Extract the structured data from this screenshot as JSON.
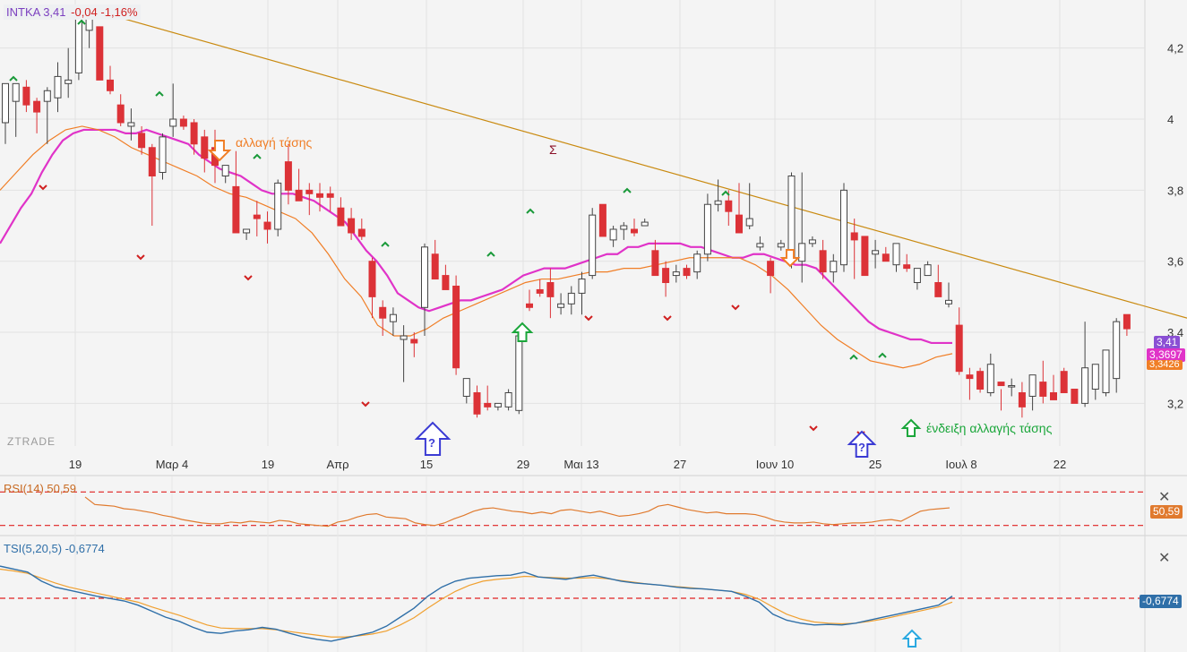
{
  "header": {
    "symbol": "INTKA",
    "last": "3,41",
    "change": "-0,04 -1,16%"
  },
  "watermark": "ZTRADE",
  "annotations": {
    "trend_change": "αλλαγή τάσης",
    "trend_change_signal": "ένδειξη αλλαγής τάσης",
    "sigma": "Σ",
    "question": "?"
  },
  "price_tags": {
    "last": "3,41",
    "ema_fast": "3,3697",
    "ema_slow": "3,3426"
  },
  "rsi": {
    "label": "RSI(14) 50,59",
    "tag": "50,59"
  },
  "tsi": {
    "label": "TSI(5,20,5) -0,6774",
    "tag": "-0,6774"
  },
  "colors": {
    "up": "#ffffff",
    "down": "#dc3237",
    "ema_fast": "#e033c8",
    "ema_slow": "#f07e26",
    "trendline": "#c98a10",
    "rsi": "#e07a2e",
    "tsi": "#2f6fa8",
    "tsi_signal": "#f0a030",
    "level": "#e02020"
  },
  "chart_data": [
    {
      "type": "candlestick",
      "title": "INTKA",
      "x_ticks": [
        "19",
        "Μαρ 4",
        "19",
        "Απρ",
        "15",
        "29",
        "Μαι 13",
        "27",
        "Ιουν 10",
        "25",
        "Ιουλ 8",
        "22"
      ],
      "y_ticks": [
        "3,2",
        "3,4",
        "3,6",
        "3,8",
        "4",
        "4,2"
      ],
      "ylim": [
        3.08,
        4.3
      ],
      "candles": [
        {
          "o": 3.99,
          "h": 4.06,
          "l": 3.93,
          "c": 4.1
        },
        {
          "o": 4.05,
          "h": 4.06,
          "l": 3.95,
          "c": 4.1
        },
        {
          "o": 4.09,
          "h": 4.11,
          "l": 4.02,
          "c": 4.04
        },
        {
          "o": 4.05,
          "h": 4.06,
          "l": 3.96,
          "c": 4.02
        },
        {
          "o": 4.05,
          "h": 4.09,
          "l": 3.93,
          "c": 4.08
        },
        {
          "o": 4.06,
          "h": 4.16,
          "l": 4.02,
          "c": 4.12
        },
        {
          "o": 4.1,
          "h": 4.2,
          "l": 4.06,
          "c": 4.11
        },
        {
          "o": 4.13,
          "h": 4.3,
          "l": 4.11,
          "c": 4.29
        },
        {
          "o": 4.25,
          "h": 4.31,
          "l": 4.2,
          "c": 4.3
        },
        {
          "o": 4.26,
          "h": 4.25,
          "l": 4.11,
          "c": 4.11
        },
        {
          "o": 4.11,
          "h": 4.15,
          "l": 4.07,
          "c": 4.08
        },
        {
          "o": 4.04,
          "h": 4.07,
          "l": 3.98,
          "c": 3.99
        },
        {
          "o": 3.98,
          "h": 4.03,
          "l": 3.94,
          "c": 3.99
        },
        {
          "o": 3.96,
          "h": 3.98,
          "l": 3.9,
          "c": 3.92
        },
        {
          "o": 3.92,
          "h": 3.93,
          "l": 3.7,
          "c": 3.84
        },
        {
          "o": 3.85,
          "h": 3.96,
          "l": 3.83,
          "c": 3.95
        },
        {
          "o": 3.98,
          "h": 4.1,
          "l": 3.95,
          "c": 4.0
        },
        {
          "o": 4.0,
          "h": 4.01,
          "l": 3.97,
          "c": 3.98
        },
        {
          "o": 3.99,
          "h": 4.0,
          "l": 3.9,
          "c": 3.93
        },
        {
          "o": 3.95,
          "h": 3.97,
          "l": 3.85,
          "c": 3.89
        },
        {
          "o": 3.92,
          "h": 3.97,
          "l": 3.82,
          "c": 3.87
        },
        {
          "o": 3.84,
          "h": 3.85,
          "l": 3.82,
          "c": 3.87
        },
        {
          "o": 3.81,
          "h": 3.91,
          "l": 3.68,
          "c": 3.68
        },
        {
          "o": 3.68,
          "h": 3.69,
          "l": 3.66,
          "c": 3.69
        },
        {
          "o": 3.73,
          "h": 3.77,
          "l": 3.67,
          "c": 3.72
        },
        {
          "o": 3.71,
          "h": 3.74,
          "l": 3.65,
          "c": 3.69
        },
        {
          "o": 3.69,
          "h": 3.83,
          "l": 3.67,
          "c": 3.82
        },
        {
          "o": 3.88,
          "h": 3.93,
          "l": 3.76,
          "c": 3.8
        },
        {
          "o": 3.8,
          "h": 3.86,
          "l": 3.77,
          "c": 3.77
        },
        {
          "o": 3.8,
          "h": 3.82,
          "l": 3.73,
          "c": 3.79
        },
        {
          "o": 3.79,
          "h": 3.82,
          "l": 3.74,
          "c": 3.78
        },
        {
          "o": 3.79,
          "h": 3.81,
          "l": 3.74,
          "c": 3.78
        },
        {
          "o": 3.75,
          "h": 3.78,
          "l": 3.72,
          "c": 3.7
        },
        {
          "o": 3.72,
          "h": 3.75,
          "l": 3.66,
          "c": 3.68
        },
        {
          "o": 3.69,
          "h": 3.72,
          "l": 3.66,
          "c": 3.67
        },
        {
          "o": 3.6,
          "h": 3.61,
          "l": 3.44,
          "c": 3.5
        },
        {
          "o": 3.47,
          "h": 3.49,
          "l": 3.39,
          "c": 3.44
        },
        {
          "o": 3.43,
          "h": 3.47,
          "l": 3.39,
          "c": 3.45
        },
        {
          "o": 3.38,
          "h": 3.42,
          "l": 3.26,
          "c": 3.39
        },
        {
          "o": 3.38,
          "h": 3.4,
          "l": 3.33,
          "c": 3.37
        },
        {
          "o": 3.47,
          "h": 3.65,
          "l": 3.39,
          "c": 3.64
        },
        {
          "o": 3.62,
          "h": 3.66,
          "l": 3.55,
          "c": 3.55
        },
        {
          "o": 3.56,
          "h": 3.59,
          "l": 3.52,
          "c": 3.52
        },
        {
          "o": 3.53,
          "h": 3.56,
          "l": 3.28,
          "c": 3.3
        },
        {
          "o": 3.22,
          "h": 3.27,
          "l": 3.2,
          "c": 3.27
        },
        {
          "o": 3.23,
          "h": 3.25,
          "l": 3.16,
          "c": 3.17
        },
        {
          "o": 3.2,
          "h": 3.25,
          "l": 3.18,
          "c": 3.19
        },
        {
          "o": 3.19,
          "h": 3.2,
          "l": 3.18,
          "c": 3.2
        },
        {
          "o": 3.19,
          "h": 3.24,
          "l": 3.18,
          "c": 3.23
        },
        {
          "o": 3.18,
          "h": 3.4,
          "l": 3.17,
          "c": 3.39
        },
        {
          "o": 3.48,
          "h": 3.52,
          "l": 3.46,
          "c": 3.47
        },
        {
          "o": 3.52,
          "h": 3.55,
          "l": 3.5,
          "c": 3.51
        },
        {
          "o": 3.54,
          "h": 3.58,
          "l": 3.44,
          "c": 3.5
        },
        {
          "o": 3.47,
          "h": 3.51,
          "l": 3.45,
          "c": 3.48
        },
        {
          "o": 3.48,
          "h": 3.53,
          "l": 3.45,
          "c": 3.51
        },
        {
          "o": 3.51,
          "h": 3.57,
          "l": 3.45,
          "c": 3.55
        },
        {
          "o": 3.56,
          "h": 3.75,
          "l": 3.55,
          "c": 3.73
        },
        {
          "o": 3.76,
          "h": 3.74,
          "l": 3.71,
          "c": 3.67
        },
        {
          "o": 3.66,
          "h": 3.7,
          "l": 3.64,
          "c": 3.69
        },
        {
          "o": 3.69,
          "h": 3.71,
          "l": 3.66,
          "c": 3.7
        },
        {
          "o": 3.69,
          "h": 3.72,
          "l": 3.67,
          "c": 3.68
        },
        {
          "o": 3.7,
          "h": 3.72,
          "l": 3.7,
          "c": 3.71
        },
        {
          "o": 3.63,
          "h": 3.66,
          "l": 3.56,
          "c": 3.56
        },
        {
          "o": 3.58,
          "h": 3.6,
          "l": 3.5,
          "c": 3.54
        },
        {
          "o": 3.56,
          "h": 3.59,
          "l": 3.54,
          "c": 3.57
        },
        {
          "o": 3.58,
          "h": 3.59,
          "l": 3.55,
          "c": 3.56
        },
        {
          "o": 3.57,
          "h": 3.63,
          "l": 3.55,
          "c": 3.62
        },
        {
          "o": 3.62,
          "h": 3.79,
          "l": 3.6,
          "c": 3.76
        },
        {
          "o": 3.76,
          "h": 3.83,
          "l": 3.74,
          "c": 3.77
        },
        {
          "o": 3.77,
          "h": 3.8,
          "l": 3.7,
          "c": 3.74
        },
        {
          "o": 3.73,
          "h": 3.82,
          "l": 3.7,
          "c": 3.68
        },
        {
          "o": 3.7,
          "h": 3.82,
          "l": 3.69,
          "c": 3.72
        },
        {
          "o": 3.64,
          "h": 3.67,
          "l": 3.63,
          "c": 3.65
        },
        {
          "o": 3.6,
          "h": 3.61,
          "l": 3.51,
          "c": 3.56
        },
        {
          "o": 3.64,
          "h": 3.66,
          "l": 3.63,
          "c": 3.65
        },
        {
          "o": 3.6,
          "h": 3.85,
          "l": 3.58,
          "c": 3.84
        },
        {
          "o": 3.6,
          "h": 3.85,
          "l": 3.54,
          "c": 3.65
        },
        {
          "o": 3.65,
          "h": 3.67,
          "l": 3.64,
          "c": 3.66
        },
        {
          "o": 3.63,
          "h": 3.66,
          "l": 3.55,
          "c": 3.57
        },
        {
          "o": 3.57,
          "h": 3.62,
          "l": 3.54,
          "c": 3.6
        },
        {
          "o": 3.59,
          "h": 3.82,
          "l": 3.57,
          "c": 3.8
        },
        {
          "o": 3.68,
          "h": 3.72,
          "l": 3.55,
          "c": 3.66
        },
        {
          "o": 3.67,
          "h": 3.66,
          "l": 3.57,
          "c": 3.56
        },
        {
          "o": 3.62,
          "h": 3.66,
          "l": 3.58,
          "c": 3.63
        },
        {
          "o": 3.62,
          "h": 3.64,
          "l": 3.6,
          "c": 3.6
        },
        {
          "o": 3.59,
          "h": 3.65,
          "l": 3.57,
          "c": 3.65
        },
        {
          "o": 3.59,
          "h": 3.62,
          "l": 3.57,
          "c": 3.58
        },
        {
          "o": 3.54,
          "h": 3.58,
          "l": 3.52,
          "c": 3.58
        },
        {
          "o": 3.56,
          "h": 3.6,
          "l": 3.56,
          "c": 3.59
        },
        {
          "o": 3.54,
          "h": 3.59,
          "l": 3.52,
          "c": 3.5
        },
        {
          "o": 3.48,
          "h": 3.54,
          "l": 3.47,
          "c": 3.49
        },
        {
          "o": 3.42,
          "h": 3.47,
          "l": 3.28,
          "c": 3.29
        },
        {
          "o": 3.28,
          "h": 3.3,
          "l": 3.21,
          "c": 3.27
        },
        {
          "o": 3.29,
          "h": 3.3,
          "l": 3.23,
          "c": 3.24
        },
        {
          "o": 3.23,
          "h": 3.34,
          "l": 3.22,
          "c": 3.31
        },
        {
          "o": 3.26,
          "h": 3.24,
          "l": 3.18,
          "c": 3.25
        },
        {
          "o": 3.25,
          "h": 3.27,
          "l": 3.22,
          "c": 3.25
        },
        {
          "o": 3.23,
          "h": 3.26,
          "l": 3.16,
          "c": 3.19
        },
        {
          "o": 3.22,
          "h": 3.27,
          "l": 3.18,
          "c": 3.28
        },
        {
          "o": 3.26,
          "h": 3.32,
          "l": 3.2,
          "c": 3.22
        },
        {
          "o": 3.23,
          "h": 3.28,
          "l": 3.21,
          "c": 3.21
        },
        {
          "o": 3.29,
          "h": 3.3,
          "l": 3.23,
          "c": 3.23
        },
        {
          "o": 3.24,
          "h": 3.24,
          "l": 3.2,
          "c": 3.2
        },
        {
          "o": 3.2,
          "h": 3.43,
          "l": 3.19,
          "c": 3.3
        },
        {
          "o": 3.24,
          "h": 3.3,
          "l": 3.21,
          "c": 3.31
        },
        {
          "o": 3.23,
          "h": 3.35,
          "l": 3.22,
          "c": 3.35
        },
        {
          "o": 3.27,
          "h": 3.44,
          "l": 3.23,
          "c": 3.43
        },
        {
          "o": 3.45,
          "h": 3.42,
          "l": 3.39,
          "c": 3.41
        }
      ],
      "ema_fast": [
        3.65,
        3.7,
        3.75,
        3.79,
        3.85,
        3.9,
        3.94,
        3.96,
        3.97,
        3.97,
        3.97,
        3.97,
        3.96,
        3.96,
        3.97,
        3.96,
        3.95,
        3.94,
        3.93,
        3.9,
        3.88,
        3.86,
        3.85,
        3.84,
        3.82,
        3.8,
        3.79,
        3.79,
        3.79,
        3.78,
        3.77,
        3.75,
        3.73,
        3.71,
        3.67,
        3.63,
        3.6,
        3.56,
        3.51,
        3.49,
        3.47,
        3.46,
        3.47,
        3.48,
        3.49,
        3.49,
        3.5,
        3.51,
        3.52,
        3.54,
        3.56,
        3.57,
        3.58,
        3.58,
        3.58,
        3.59,
        3.6,
        3.61,
        3.62,
        3.62,
        3.64,
        3.64,
        3.65,
        3.65,
        3.65,
        3.65,
        3.64,
        3.64,
        3.63,
        3.62,
        3.61,
        3.61,
        3.62,
        3.62,
        3.61,
        3.6,
        3.59,
        3.59,
        3.58,
        3.55,
        3.52,
        3.49,
        3.46,
        3.43,
        3.41,
        3.4,
        3.39,
        3.38,
        3.38,
        3.37,
        3.37,
        3.37
      ],
      "ema_slow": [
        3.8,
        3.85,
        3.9,
        3.94,
        3.97,
        3.98,
        3.97,
        3.95,
        3.92,
        3.9,
        3.88,
        3.86,
        3.84,
        3.81,
        3.79,
        3.78,
        3.76,
        3.74,
        3.72,
        3.68,
        3.62,
        3.55,
        3.5,
        3.42,
        3.39,
        3.39,
        3.41,
        3.44,
        3.46,
        3.48,
        3.5,
        3.52,
        3.54,
        3.55,
        3.55,
        3.56,
        3.57,
        3.57,
        3.58,
        3.58,
        3.59,
        3.6,
        3.61,
        3.61,
        3.61,
        3.61,
        3.59,
        3.56,
        3.52,
        3.47,
        3.42,
        3.38,
        3.35,
        3.32,
        3.31,
        3.3,
        3.31,
        3.33,
        3.34
      ],
      "trendline": {
        "from_bar": 8,
        "from": 4.31,
        "to": 3.44,
        "extends_to_right_edge": true
      },
      "rsi": {
        "x_start": 8,
        "values": [
          64,
          55,
          54,
          53,
          50,
          49,
          47,
          45,
          42,
          40,
          37,
          35,
          33,
          32,
          32,
          34,
          33,
          35,
          34,
          33,
          36,
          35,
          32,
          31,
          30,
          29,
          34,
          36,
          40,
          43,
          44,
          40,
          39,
          38,
          33,
          31,
          30,
          33,
          38,
          42,
          47,
          50,
          51,
          49,
          47,
          46,
          44,
          46,
          44,
          48,
          49,
          47,
          45,
          47,
          44,
          41,
          42,
          44,
          47,
          53,
          55,
          52,
          49,
          47,
          45,
          46,
          44,
          44,
          44,
          43,
          40,
          36,
          34,
          33,
          33,
          34,
          32,
          31,
          32,
          33,
          33,
          34,
          36,
          37,
          35,
          41,
          47,
          49,
          50,
          51
        ]
      },
      "tsi": {
        "values": [
          0.3,
          0.25,
          0.2,
          0.05,
          -0.05,
          -0.1,
          -0.15,
          -0.2,
          -0.24,
          -0.28,
          -0.35,
          -0.45,
          -0.55,
          -0.62,
          -0.72,
          -0.8,
          -0.82,
          -0.78,
          -0.76,
          -0.72,
          -0.75,
          -0.82,
          -0.88,
          -0.92,
          -0.95,
          -0.9,
          -0.85,
          -0.8,
          -0.7,
          -0.55,
          -0.4,
          -0.2,
          -0.05,
          0.05,
          0.1,
          0.12,
          0.14,
          0.15,
          0.2,
          0.12,
          0.1,
          0.08,
          0.12,
          0.15,
          0.1,
          0.05,
          0.02,
          0.0,
          -0.02,
          -0.05,
          -0.07,
          -0.08,
          -0.1,
          -0.12,
          -0.2,
          -0.3,
          -0.5,
          -0.6,
          -0.65,
          -0.68,
          -0.67,
          -0.68,
          -0.65,
          -0.6,
          -0.55,
          -0.5,
          -0.45,
          -0.4,
          -0.35,
          -0.2
        ],
        "signal": [
          0.25,
          0.22,
          0.18,
          0.1,
          0.02,
          -0.05,
          -0.1,
          -0.15,
          -0.2,
          -0.25,
          -0.3,
          -0.38,
          -0.45,
          -0.52,
          -0.6,
          -0.68,
          -0.73,
          -0.74,
          -0.74,
          -0.74,
          -0.76,
          -0.79,
          -0.82,
          -0.85,
          -0.88,
          -0.88,
          -0.86,
          -0.83,
          -0.78,
          -0.68,
          -0.56,
          -0.4,
          -0.25,
          -0.12,
          -0.02,
          0.05,
          0.08,
          0.1,
          0.13,
          0.12,
          0.11,
          0.1,
          0.1,
          0.11,
          0.09,
          0.06,
          0.03,
          0.0,
          -0.02,
          -0.04,
          -0.06,
          -0.08,
          -0.1,
          -0.12,
          -0.17,
          -0.25,
          -0.38,
          -0.5,
          -0.58,
          -0.63,
          -0.65,
          -0.66,
          -0.65,
          -0.62,
          -0.58,
          -0.53,
          -0.48,
          -0.43,
          -0.38,
          -0.3
        ]
      }
    }
  ]
}
